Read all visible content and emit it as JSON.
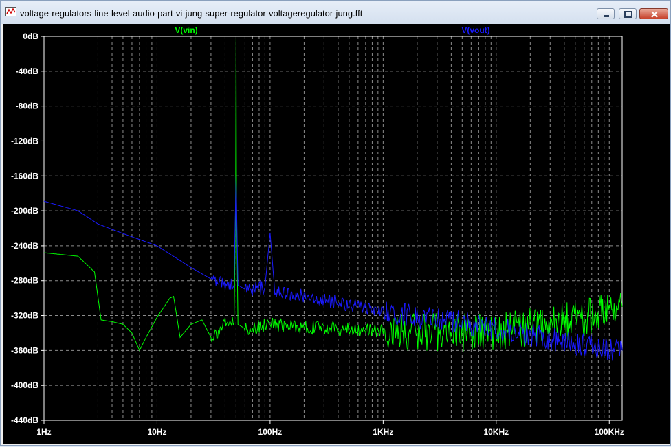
{
  "window": {
    "title": "voltage-regulators-line-level-audio-part-vi-jung-super-regulator-voltageregulator-jung.fft",
    "icon": "waveform-chart-icon",
    "buttons": [
      "minimize-icon",
      "restore-icon",
      "close-icon"
    ]
  },
  "colors": {
    "background": "#000000",
    "grid": "#8c8c8c",
    "axis_text": "#ffffff",
    "vin": "#00ff00",
    "vout": "#1a1aff"
  },
  "chart_data": {
    "type": "line",
    "title": "",
    "xlabel": "",
    "ylabel": "",
    "x_scale": "log",
    "xlim": [
      1,
      130000
    ],
    "ylim": [
      -440,
      0
    ],
    "x_ticks": [
      "1Hz",
      "10Hz",
      "100Hz",
      "1KHz",
      "10KHz",
      "100KHz"
    ],
    "y_ticks": [
      "0dB",
      "-40dB",
      "-80dB",
      "-120dB",
      "-160dB",
      "-200dB",
      "-240dB",
      "-280dB",
      "-320dB",
      "-360dB",
      "-400dB",
      "-440dB"
    ],
    "grid": true,
    "legend": "top",
    "series": [
      {
        "name": "V(vin)",
        "color": "#00ff00",
        "x": [
          1,
          2,
          2.8,
          3.2,
          4,
          5,
          6,
          7,
          8,
          10,
          13,
          14,
          16,
          20,
          25,
          30,
          40,
          48,
          49.5,
          50,
          50.5,
          52,
          60,
          100,
          200,
          1000,
          10000,
          50000,
          100000,
          130000
        ],
        "y": [
          -248,
          -252,
          -270,
          -325,
          -327,
          -330,
          -340,
          -360,
          -345,
          -322,
          -300,
          -298,
          -345,
          -330,
          -325,
          -345,
          -330,
          -328,
          -200,
          -3,
          -200,
          -330,
          -335,
          -330,
          -333,
          -338,
          -340,
          -325,
          -315,
          -310
        ]
      },
      {
        "name": "V(vout)",
        "color": "#1a1aff",
        "x": [
          1,
          2,
          3,
          5,
          10,
          20,
          30,
          40,
          48,
          50,
          52,
          60,
          90,
          100,
          110,
          200,
          1000,
          10000,
          50000,
          100000,
          130000
        ],
        "y": [
          -189,
          -200,
          -215,
          -226,
          -240,
          -265,
          -278,
          -283,
          -285,
          -160,
          -285,
          -290,
          -288,
          -225,
          -292,
          -298,
          -315,
          -335,
          -352,
          -358,
          -360
        ]
      }
    ]
  }
}
